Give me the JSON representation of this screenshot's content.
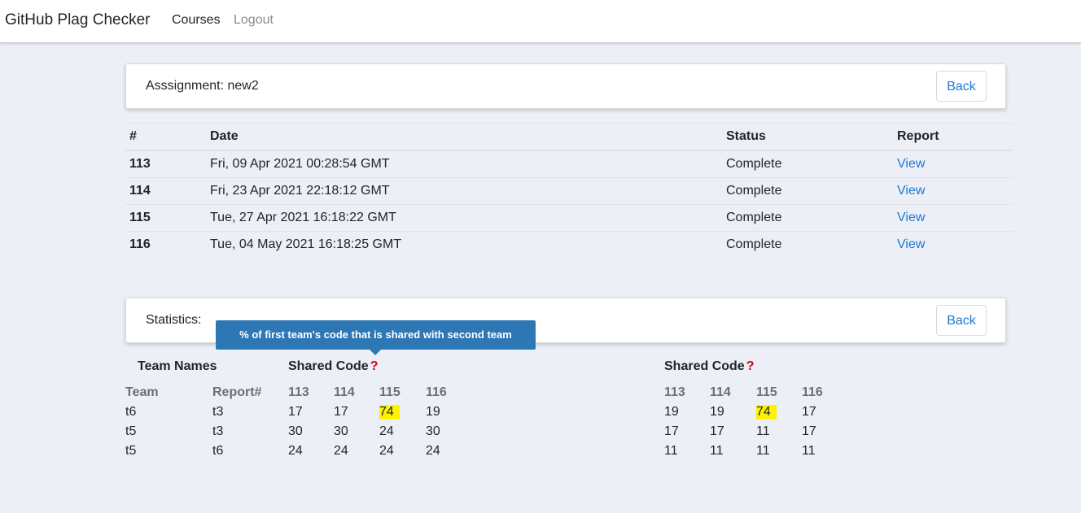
{
  "navbar": {
    "brand": "GitHub Plag Checker",
    "courses": "Courses",
    "logout": "Logout"
  },
  "assignment_card": {
    "title": "Asssignment: new2",
    "back_label": "Back"
  },
  "runs_table": {
    "headers": [
      "#",
      "Date",
      "Status",
      "Report"
    ],
    "rows": [
      {
        "id": "113",
        "date": "Fri, 09 Apr 2021 00:28:54 GMT",
        "status": "Complete",
        "report": "View"
      },
      {
        "id": "114",
        "date": "Fri, 23 Apr 2021 22:18:12 GMT",
        "status": "Complete",
        "report": "View"
      },
      {
        "id": "115",
        "date": "Tue, 27 Apr 2021 16:18:22 GMT",
        "status": "Complete",
        "report": "View"
      },
      {
        "id": "116",
        "date": "Tue, 04 May 2021 16:18:25 GMT",
        "status": "Complete",
        "report": "View"
      }
    ]
  },
  "stats_card": {
    "title": "Statistics:",
    "back_label": "Back"
  },
  "tooltip": "% of first team's code that is shared with second team",
  "stats": {
    "team_names_heading": "Team Names",
    "shared_code_heading": "Shared Code",
    "shared_code_heading_2": "Shared Code",
    "help_icon": "question-icon",
    "team_col": "Team",
    "report_col": "Report#",
    "report_ids": [
      "113",
      "114",
      "115",
      "116"
    ],
    "rows": [
      {
        "team": "t6",
        "other": "t3",
        "left": [
          "17",
          "17",
          "74",
          "19"
        ],
        "right": [
          "19",
          "19",
          "74",
          "17"
        ]
      },
      {
        "team": "t5",
        "other": "t3",
        "left": [
          "30",
          "30",
          "24",
          "30"
        ],
        "right": [
          "17",
          "17",
          "11",
          "17"
        ]
      },
      {
        "team": "t5",
        "other": "t6",
        "left": [
          "24",
          "24",
          "24",
          "24"
        ],
        "right": [
          "11",
          "11",
          "11",
          "11"
        ]
      }
    ],
    "highlight_color": "#fff200"
  }
}
